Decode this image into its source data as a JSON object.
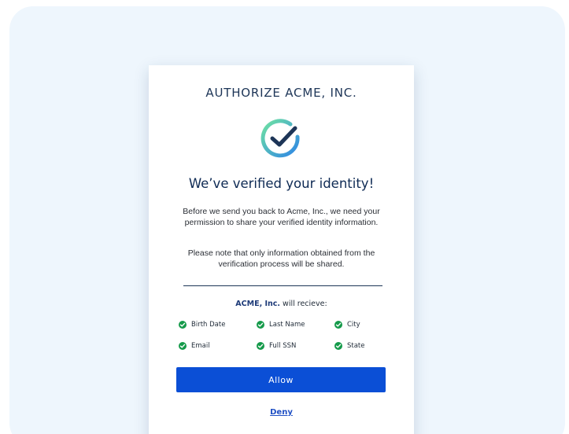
{
  "card": {
    "title": "AUTHORIZE ACME, INC.",
    "logo_icon": "circle-check-icon",
    "heading": "We’ve verified your identity!",
    "paragraph_1": "Before we send you back to Acme, Inc., we need your permission to share your verified identity information.",
    "paragraph_2": "Please note that only information obtained from the verification process will be shared.",
    "receive": {
      "brand": "ACME, Inc.",
      "text": " will recieve:"
    },
    "permissions": [
      "Birth Date",
      "Last Name",
      "City",
      "Email",
      "Full SSN",
      "State"
    ],
    "allow_label": "Allow",
    "deny_label": "Deny"
  },
  "colors": {
    "background_panel": "#eef6fd",
    "accent_blue": "#0b4fd6",
    "check_green": "#159a4a",
    "heading_navy": "#0e2a54",
    "logo_gradient_start": "#5fe0a0",
    "logo_gradient_end": "#2f7fe6"
  }
}
